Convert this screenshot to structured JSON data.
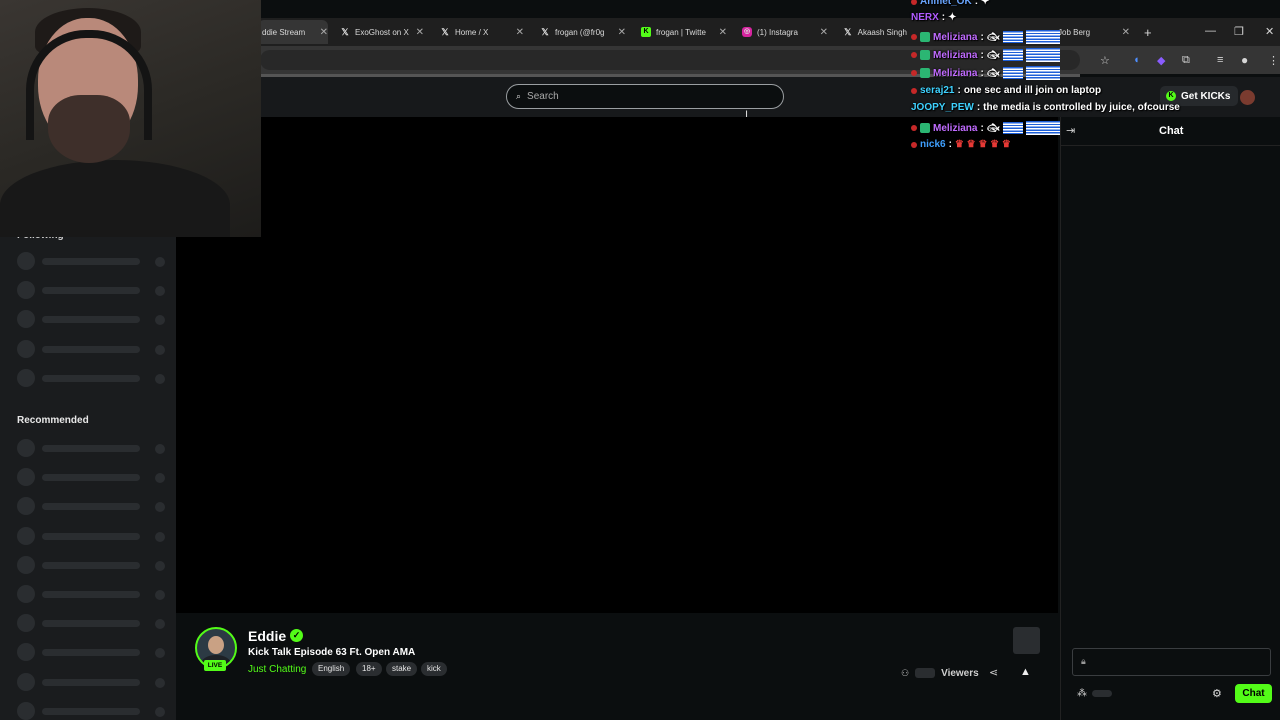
{
  "browser": {
    "tabs": [
      {
        "label": "ddie Stream",
        "icon": "kick-icon",
        "active": true
      },
      {
        "label": "ExoGhost on X",
        "icon": "x-icon"
      },
      {
        "label": "Home / X",
        "icon": "x-icon"
      },
      {
        "label": "frogan (@fr0g",
        "icon": "x-icon"
      },
      {
        "label": "frogan | Twitte",
        "icon": "kick-icon"
      },
      {
        "label": "(1) Instagra",
        "icon": "instagram-icon"
      },
      {
        "label": "Akaash Singh",
        "icon": "x-icon"
      },
      {
        "label": "Job Berg",
        "icon": "kick-icon"
      }
    ]
  },
  "topnav": {
    "search_placeholder": "Search",
    "get_kicks_label": "Get KICKs"
  },
  "sidebar": {
    "following_label": "Following",
    "recommended_label": "Recommended"
  },
  "stream": {
    "channel_name": "Eddie",
    "title": "Kick Talk Episode 63 Ft. Open AMA",
    "category": "Just Chatting",
    "tags": [
      "English",
      "18+",
      "stake",
      "kick"
    ],
    "live_label": "LIVE",
    "viewers_label": "Viewers"
  },
  "chat": {
    "title": "Chat",
    "send_label": "Chat"
  },
  "chat_overlay": [
    {
      "user": "Ahmet_OK",
      "color": "#6aa6ff",
      "msg": ""
    },
    {
      "user": "NERX",
      "color": "#b05cff",
      "msg": ""
    },
    {
      "user": "Meliziana",
      "color": "#c06bff",
      "msg": ""
    },
    {
      "user": "Meliziana",
      "color": "#c06bff",
      "msg": ""
    },
    {
      "user": "Meliziana",
      "color": "#c06bff",
      "msg": ""
    },
    {
      "user": "seraj21",
      "color": "#3fd2ff",
      "msg": "one sec and ill join on laptop"
    },
    {
      "user": "JOOPY_PEW",
      "color": "#3fd2ff",
      "msg": "the media is controlled by juice, ofcourse"
    },
    {
      "user": "Meliziana",
      "color": "#c06bff",
      "msg": ""
    },
    {
      "user": "nick6",
      "color": "#3fa0ff",
      "msg": ""
    }
  ]
}
